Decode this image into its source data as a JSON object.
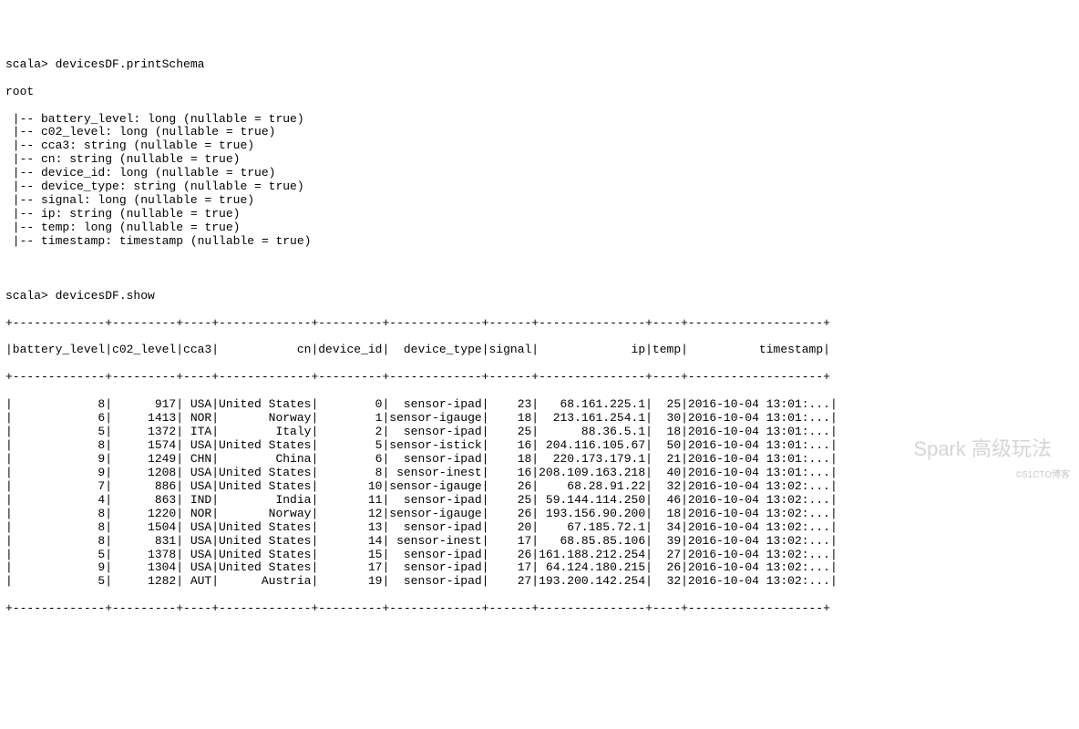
{
  "prompt1": "scala> ",
  "cmd1": "devicesDF.printSchema",
  "schema": {
    "root": "root",
    "fields": [
      "battery_level: long (nullable = true)",
      "c02_level: long (nullable = true)",
      "cca3: string (nullable = true)",
      "cn: string (nullable = true)",
      "device_id: long (nullable = true)",
      "device_type: string (nullable = true)",
      "signal: long (nullable = true)",
      "ip: string (nullable = true)",
      "temp: long (nullable = true)",
      "timestamp: timestamp (nullable = true)"
    ]
  },
  "prompt2": "scala> ",
  "cmd2": "devicesDF.show",
  "table": {
    "sep": "+-------------+---------+----+-------------+---------+-------------+------+---------------+----+-------------------+",
    "header": "|battery_level|c02_level|cca3|           cn|device_id|  device_type|signal|             ip|temp|          timestamp|",
    "rows": [
      "|            8|      917| USA|United States|        0|  sensor-ipad|    23|   68.161.225.1|  25|2016-10-04 13:01:...|",
      "|            6|     1413| NOR|       Norway|        1|sensor-igauge|    18|  213.161.254.1|  30|2016-10-04 13:01:...|",
      "|            5|     1372| ITA|        Italy|        2|  sensor-ipad|    25|      88.36.5.1|  18|2016-10-04 13:01:...|",
      "|            8|     1574| USA|United States|        5|sensor-istick|    16| 204.116.105.67|  50|2016-10-04 13:01:...|",
      "|            9|     1249| CHN|        China|        6|  sensor-ipad|    18|  220.173.179.1|  21|2016-10-04 13:01:...|",
      "|            9|     1208| USA|United States|        8| sensor-inest|    16|208.109.163.218|  40|2016-10-04 13:01:...|",
      "|            7|      886| USA|United States|       10|sensor-igauge|    26|    68.28.91.22|  32|2016-10-04 13:02:...|",
      "|            4|      863| IND|        India|       11|  sensor-ipad|    25| 59.144.114.250|  46|2016-10-04 13:02:...|",
      "|            8|     1220| NOR|       Norway|       12|sensor-igauge|    26| 193.156.90.200|  18|2016-10-04 13:02:...|",
      "|            8|     1504| USA|United States|       13|  sensor-ipad|    20|    67.185.72.1|  34|2016-10-04 13:02:...|",
      "|            8|      831| USA|United States|       14| sensor-inest|    17|   68.85.85.106|  39|2016-10-04 13:02:...|",
      "|            5|     1378| USA|United States|       15|  sensor-ipad|    26|161.188.212.254|  27|2016-10-04 13:02:...|",
      "|            9|     1304| USA|United States|       17|  sensor-ipad|    17| 64.124.180.215|  26|2016-10-04 13:02:...|",
      "|            5|     1282| AUT|      Austria|       19|  sensor-ipad|    27|193.200.142.254|  32|2016-10-04 13:02:...|"
    ]
  },
  "watermark": "Spark 高级玩法",
  "watermark2": "©51CTO博客"
}
